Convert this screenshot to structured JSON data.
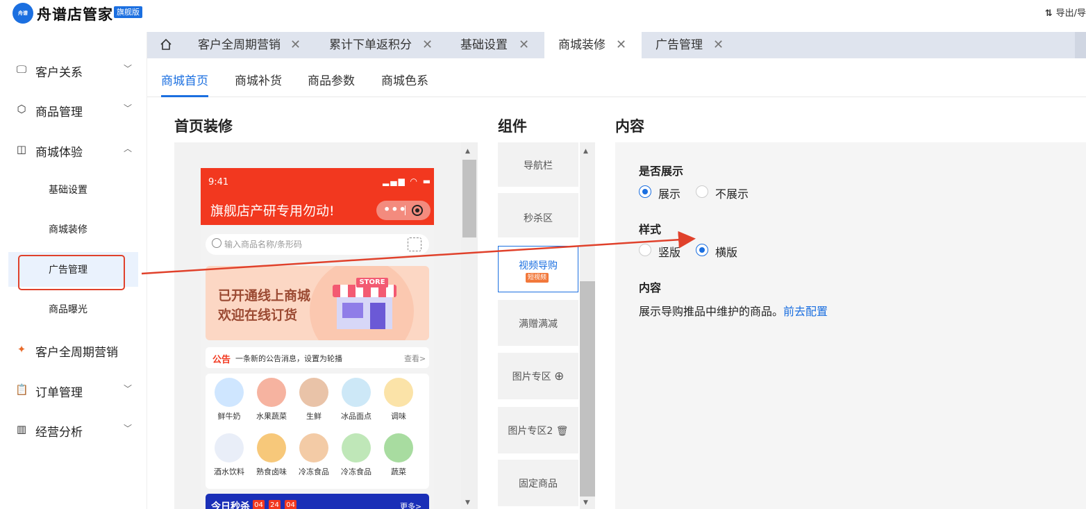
{
  "app": {
    "name": "舟谱店管家",
    "edition": "旗舰版",
    "logo_text": "舟谱"
  },
  "header": {
    "right_label": "导出/导"
  },
  "sidebar": {
    "menus": [
      {
        "label": "客户关系",
        "icon": "monitor-icon",
        "expanded": false
      },
      {
        "label": "商品管理",
        "icon": "box-icon",
        "expanded": false
      },
      {
        "label": "商城体验",
        "icon": "shopping-bag-icon",
        "expanded": true
      },
      {
        "label": "客户全周期营销",
        "icon": "marketing-icon"
      },
      {
        "label": "订单管理",
        "icon": "clipboard-icon",
        "expanded": false
      },
      {
        "label": "经营分析",
        "icon": "chart-icon",
        "expanded": false
      }
    ],
    "submenu": [
      "基础设置",
      "商城装修",
      "广告管理",
      "商品曝光"
    ],
    "active_submenu": "广告管理"
  },
  "tabs": [
    "客户全周期营销",
    "累计下单返积分",
    "基础设置",
    "商城装修",
    "广告管理"
  ],
  "active_tab": "商城装修",
  "subtabs": [
    "商城首页",
    "商城补货",
    "商品参数",
    "商城色系"
  ],
  "active_subtab": "商城首页",
  "sections": {
    "preview": "首页装修",
    "components": "组件",
    "content": "内容"
  },
  "phone": {
    "time": "9:41",
    "status": "▂▄▆ ◠ ▬",
    "title": "旗舰店产研专用勿动!",
    "search_placeholder": "输入商品名称/条形码",
    "banner_line1": "已开通线上商城",
    "banner_line2": "欢迎在线订货",
    "store_sign": "STORE",
    "notice_tag": "公告",
    "notice_msg": "一条新的公告消息，设置为轮播",
    "notice_more": "查看>",
    "categories": [
      "鲜牛奶",
      "水果蔬菜",
      "生鲜",
      "冰品面点",
      "调味",
      "酒水饮料",
      "熟食卤味",
      "冷冻食品",
      "冷冻食品",
      "蔬菜"
    ],
    "flash_title": "今日秒杀",
    "countdown": [
      "04",
      "24",
      "04"
    ],
    "flash_more": "更多>"
  },
  "components": [
    {
      "label": "导航栏"
    },
    {
      "label": "秒杀区"
    },
    {
      "label": "视频导购",
      "badge": "短视频",
      "selected": true
    },
    {
      "label": "满赠满减"
    },
    {
      "label": "图片专区",
      "icon": "⊕"
    },
    {
      "label": "图片专区2",
      "icon": "🗑"
    },
    {
      "label": "固定商品"
    }
  ],
  "settings": {
    "show_label": "是否展示",
    "show_options": [
      "展示",
      "不展示"
    ],
    "show_value": "展示",
    "style_label": "样式",
    "style_options": [
      "竖版",
      "横版"
    ],
    "style_value": "横版",
    "content_label": "内容",
    "content_desc": "展示导购推品中维护的商品。",
    "content_link": "前去配置"
  },
  "colors": {
    "primary": "#1b6fe0",
    "phone_header": "#f2381f",
    "annotation": "#e0412b"
  }
}
